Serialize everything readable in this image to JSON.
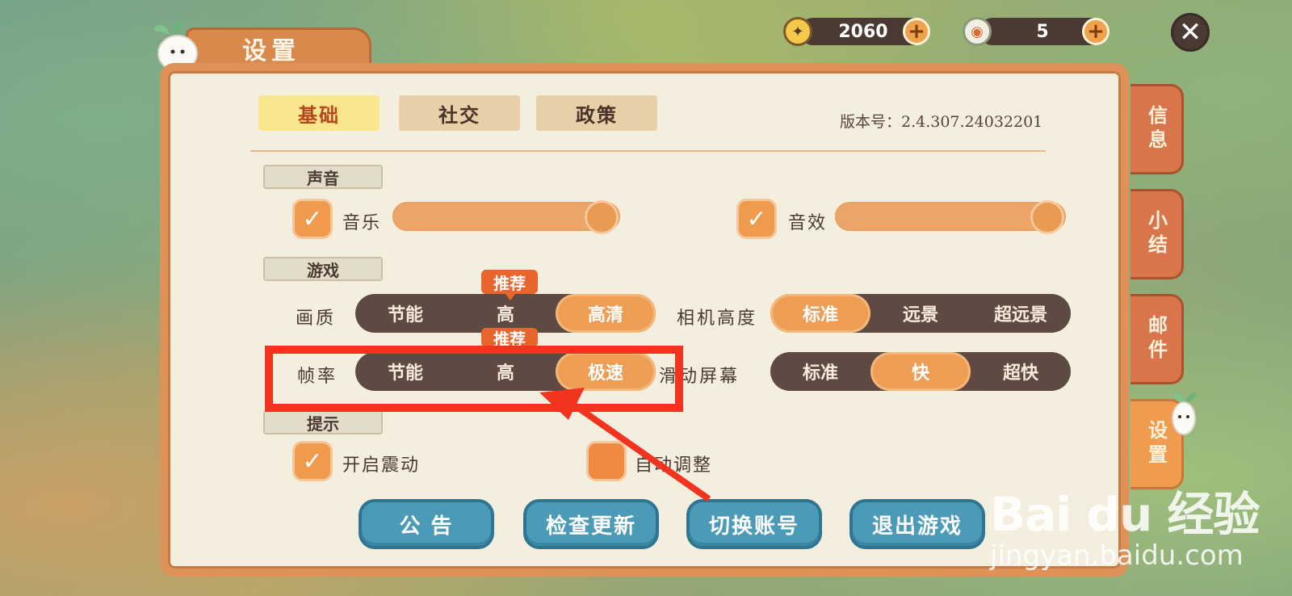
{
  "currencies": [
    {
      "icon": "star-coin-icon",
      "value": "2060"
    },
    {
      "icon": "gem-coin-icon",
      "value": "5"
    }
  ],
  "title": "设置",
  "top_tabs": [
    {
      "label": "基础",
      "active": true
    },
    {
      "label": "社交",
      "active": false
    },
    {
      "label": "政策",
      "active": false
    }
  ],
  "version": "版本号：2.4.307.24032201",
  "side_tabs": [
    {
      "label": "信息",
      "active": false
    },
    {
      "label": "小结",
      "active": false
    },
    {
      "label": "邮件",
      "active": false
    },
    {
      "label": "设置",
      "active": true
    }
  ],
  "sound": {
    "section": "声音",
    "music": {
      "label": "音乐",
      "checked": true,
      "level": 1.0
    },
    "sfx": {
      "label": "音效",
      "checked": true,
      "level": 1.0
    }
  },
  "game": {
    "section": "游戏",
    "quality": {
      "label": "画质",
      "options": [
        "节能",
        "高",
        "高清"
      ],
      "selected": 2,
      "recommended": 1
    },
    "camera": {
      "label": "相机高度",
      "options": [
        "标准",
        "远景",
        "超远景"
      ],
      "selected": 0
    },
    "framerate": {
      "label": "帧率",
      "options": [
        "节能",
        "高",
        "极速"
      ],
      "selected": 2,
      "recommended": 1
    },
    "scroll": {
      "label": "滑动屏幕",
      "options": [
        "标准",
        "快",
        "超快"
      ],
      "selected": 1
    }
  },
  "recommend_badge": "推荐",
  "hints": {
    "section": "提示",
    "vibrate": {
      "label": "开启震动",
      "checked": true
    },
    "auto_adjust": {
      "label": "自动调整",
      "checked": false
    }
  },
  "buttons": {
    "notice": "公 告",
    "check_update": "检查更新",
    "switch_account": "切换账号",
    "exit_game": "退出游戏"
  },
  "watermark": {
    "brand": "Bai du 经验",
    "url": "jingyan.baidu.com"
  },
  "colors": {
    "accent": "#ee9d55",
    "panel_border": "#df9257",
    "annotation": "#f2331e",
    "button": "#4b9bb8"
  }
}
